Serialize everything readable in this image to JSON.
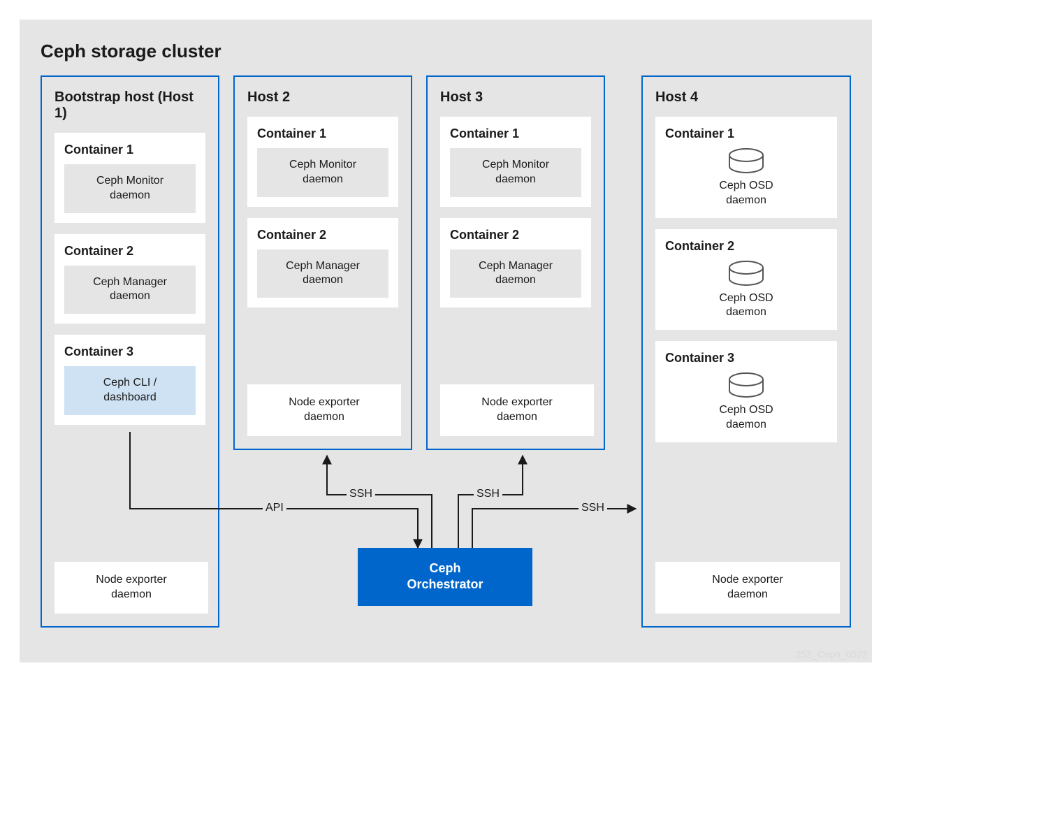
{
  "cluster_title": "Ceph storage cluster",
  "hosts": [
    {
      "title": "Bootstrap host (Host 1)",
      "containers": [
        {
          "title": "Container 1",
          "daemon": "Ceph Monitor\ndaemon",
          "style": "grey"
        },
        {
          "title": "Container 2",
          "daemon": "Ceph Manager\ndaemon",
          "style": "grey"
        },
        {
          "title": "Container 3",
          "daemon": "Ceph CLI /\ndashboard",
          "style": "blue"
        }
      ],
      "extra": "Node exporter\ndaemon"
    },
    {
      "title": "Host 2",
      "containers": [
        {
          "title": "Container 1",
          "daemon": "Ceph Monitor\ndaemon",
          "style": "grey"
        },
        {
          "title": "Container 2",
          "daemon": "Ceph Manager\ndaemon",
          "style": "grey"
        }
      ],
      "extra": "Node exporter\ndaemon"
    },
    {
      "title": "Host 3",
      "containers": [
        {
          "title": "Container 1",
          "daemon": "Ceph Monitor\ndaemon",
          "style": "grey"
        },
        {
          "title": "Container 2",
          "daemon": "Ceph Manager\ndaemon",
          "style": "grey"
        }
      ],
      "extra": "Node exporter\ndaemon"
    },
    {
      "title": "Host 4",
      "osd_containers": [
        {
          "title": "Container 1",
          "label": "Ceph OSD\ndaemon"
        },
        {
          "title": "Container 2",
          "label": "Ceph OSD\ndaemon"
        },
        {
          "title": "Container 3",
          "label": "Ceph OSD\ndaemon"
        }
      ],
      "extra": "Node exporter\ndaemon"
    }
  ],
  "orchestrator": "Ceph\nOrchestrator",
  "edges": {
    "api": "API",
    "ssh": "SSH"
  },
  "watermark": "252_Ceph_0522"
}
